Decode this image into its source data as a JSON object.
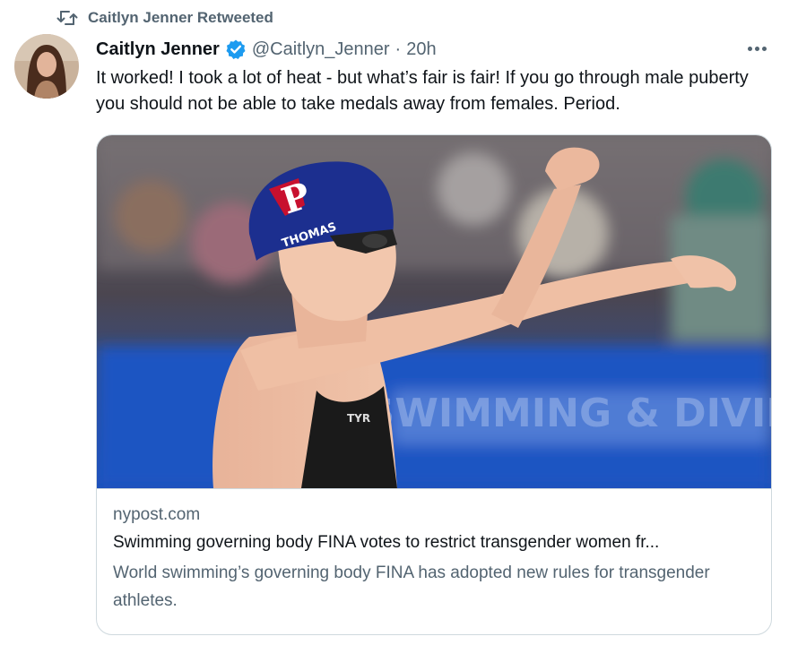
{
  "retweet": {
    "label": "Caitlyn Jenner Retweeted",
    "icon": "retweet-icon"
  },
  "tweet": {
    "display_name": "Caitlyn Jenner",
    "verified_icon": "verified-badge-icon",
    "handle": "@Caitlyn_Jenner",
    "separator": "·",
    "timestamp": "20h",
    "more_icon": "more-options-icon",
    "text": "It worked! I took a lot of heat - but what’s fair is fair! If you go through male puberty you should not be able to take medals away from females. Period."
  },
  "card": {
    "image_cap_text": "THOMAS",
    "image_cap_logo": "P",
    "image_suit_logo": "TYR",
    "image_banner_text": "SWIMMING & DIVING",
    "domain": "nypost.com",
    "title": "Swimming governing body FINA votes to restrict transgender women fr...",
    "description": "World swimming’s governing body FINA has adopted new rules for transgender athletes."
  },
  "colors": {
    "text_primary": "#0f1419",
    "text_secondary": "#536471",
    "verified": "#1d9bf0",
    "border": "#cfd9de"
  }
}
